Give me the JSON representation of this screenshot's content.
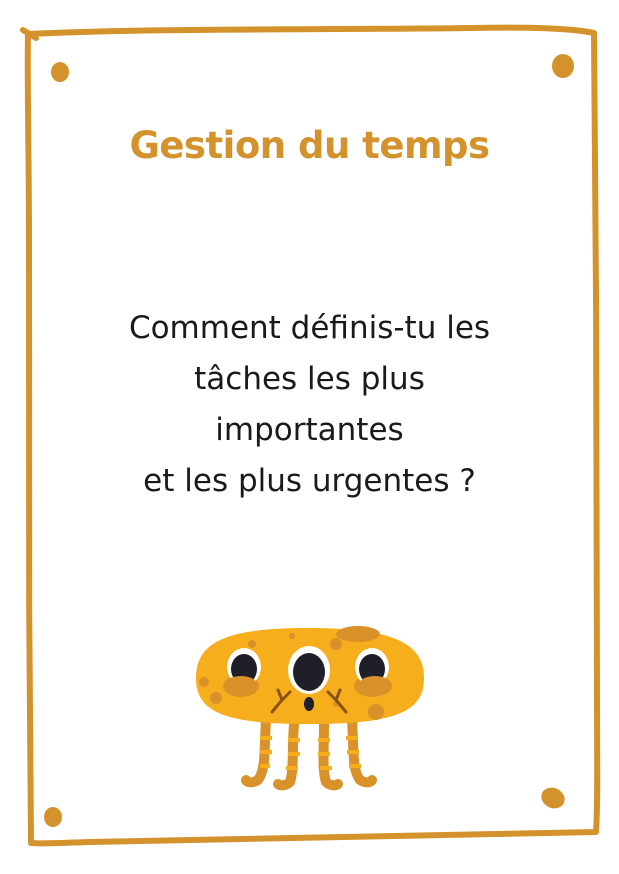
{
  "card": {
    "title": "Gestion du temps",
    "question_lines": [
      "Comment définis-tu les",
      "tâches les plus",
      "importantes",
      "et les plus urgentes ?"
    ]
  },
  "colors": {
    "accent": "#d4922c",
    "mascot_body": "#f7ae1d",
    "mascot_spots": "#d9912a",
    "text": "#1a1a1a",
    "background": "#ffffff"
  },
  "decorations": {
    "frame": "hand-drawn-border",
    "mascot": "three-eyed-yellow-monster-icon"
  }
}
